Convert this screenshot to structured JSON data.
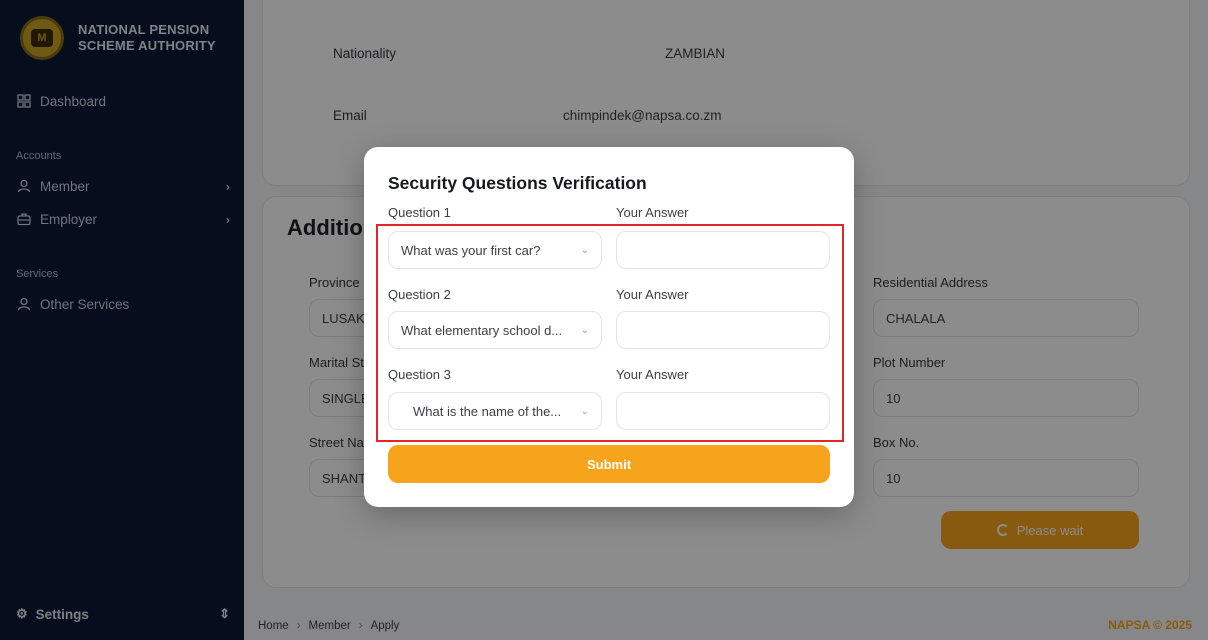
{
  "brand": {
    "line1": "NATIONAL PENSION",
    "line2": "SCHEME AUTHORITY",
    "logo_letter": "M"
  },
  "sidebar": {
    "dashboard": "Dashboard",
    "accounts_section": "Accounts",
    "member": "Member",
    "employer": "Employer",
    "services_section": "Services",
    "other_services": "Other Services",
    "settings": "Settings"
  },
  "profile": {
    "nationality_label": "Nationality",
    "nationality_value": "ZAMBIAN",
    "email_label": "Email",
    "email_value": "chimpindek@napsa.co.zm"
  },
  "additional": {
    "title": "Additional Details",
    "province_label": "Province",
    "province_value": "LUSAKA",
    "marital_label": "Marital Status",
    "marital_value": "SINGLE",
    "street_label": "Street Name",
    "street_value": "SHANTUMBU",
    "residential_label": "Residential Address",
    "residential_value": "CHALALA",
    "plot_label": "Plot Number",
    "plot_value": "10",
    "box_label": "Box No.",
    "box_value": "10",
    "wait_button": "Please wait"
  },
  "breadcrumb": [
    "Home",
    "Member",
    "Apply"
  ],
  "footer": {
    "copyright": "NAPSA © 2025"
  },
  "modal": {
    "title": "Security Questions Verification",
    "answer_label": "Your Answer",
    "questions": [
      {
        "label": "Question 1",
        "selected": "What was your first car?"
      },
      {
        "label": "Question 2",
        "selected": "What elementary school d..."
      },
      {
        "label": "Question 3",
        "selected": "What is the name of the..."
      }
    ],
    "submit": "Submit"
  },
  "colors": {
    "sidebar": "#0b1a36",
    "accent": "#f7a41d",
    "highlight": "#e0262b"
  }
}
